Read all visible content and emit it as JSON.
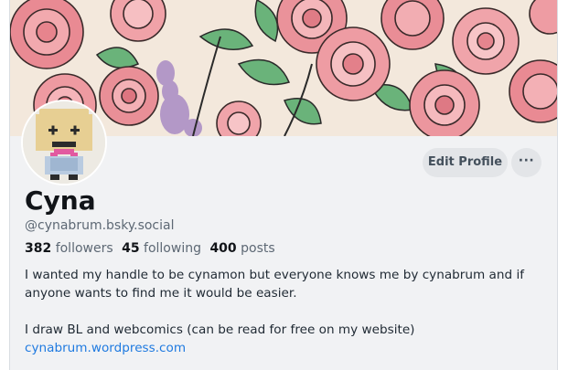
{
  "profile": {
    "display_name": "Cyna",
    "handle": "@cynabrum.bsky.social",
    "stats": {
      "followers_count": "382",
      "followers_label": "followers",
      "following_count": "45",
      "following_label": "following",
      "posts_count": "400",
      "posts_label": "posts"
    },
    "bio": {
      "paragraph_1": "I wanted my handle to be cynamon but everyone knows me by cynabrum and if anyone wants to find me it would be easier.",
      "paragraph_2": "I draw BL and webcomics (can be read for free on my website)",
      "link": "cynabrum.wordpress.com"
    }
  },
  "actions": {
    "edit_profile_label": "Edit Profile",
    "more_label": "···"
  },
  "icons": {
    "more": "ellipsis-icon"
  },
  "colors": {
    "accent_link": "#1f7ae0",
    "button_bg": "#e3e5e8",
    "panel_bg": "#f1f2f4"
  }
}
